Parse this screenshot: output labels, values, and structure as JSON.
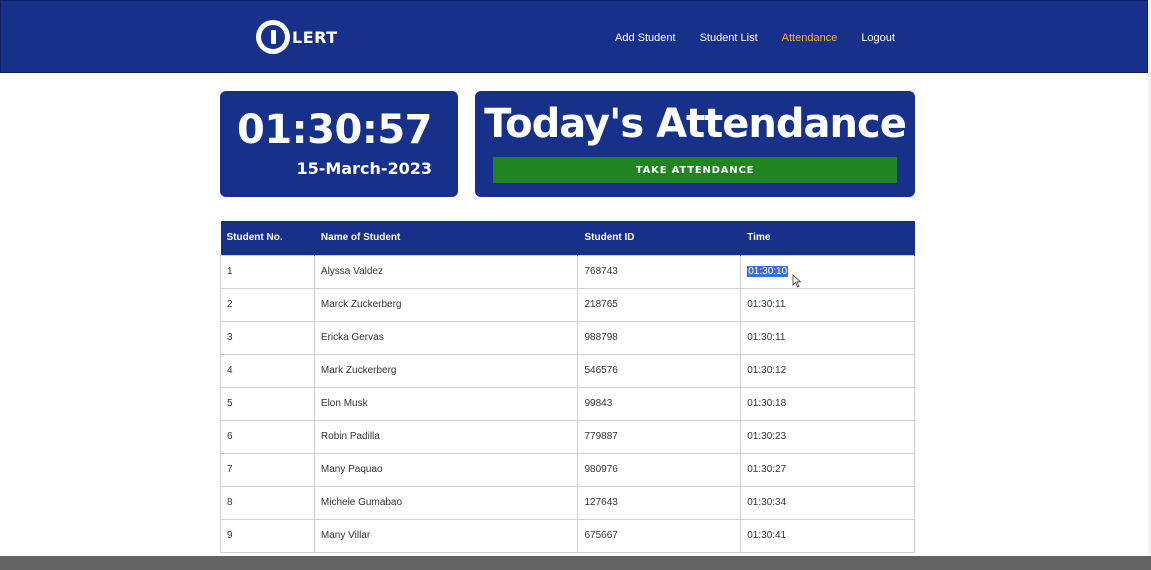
{
  "brand": {
    "logo_text": "LERT"
  },
  "nav": {
    "items": [
      {
        "label": "Add Student",
        "active": false
      },
      {
        "label": "Student List",
        "active": false
      },
      {
        "label": "Attendance",
        "active": true
      },
      {
        "label": "Logout",
        "active": false
      }
    ]
  },
  "clock": {
    "time": "01:30:57",
    "date": "15-March-2023"
  },
  "attendance": {
    "title": "Today's Attendance",
    "take_button_label": "TAKE ATTENDANCE"
  },
  "table": {
    "headers": [
      "Student No.",
      "Name of Student",
      "Student ID",
      "Time"
    ],
    "rows": [
      {
        "no": "1",
        "name": "Alyssa Valdez",
        "id": "768743",
        "time": "01:30:10"
      },
      {
        "no": "2",
        "name": "Marck Zuckerberg",
        "id": "218765",
        "time": "01:30:11"
      },
      {
        "no": "3",
        "name": "Ericka Gervas",
        "id": "988798",
        "time": "01:30:11"
      },
      {
        "no": "4",
        "name": "Mark Zuckerberg",
        "id": "546576",
        "time": "01:30:12"
      },
      {
        "no": "5",
        "name": "Elon Musk",
        "id": "99843",
        "time": "01:30:18"
      },
      {
        "no": "6",
        "name": "Robin Padilla",
        "id": "779887",
        "time": "01:30:23"
      },
      {
        "no": "7",
        "name": "Many Paquao",
        "id": "980976",
        "time": "01:30:27"
      },
      {
        "no": "8",
        "name": "Michele Gumabao",
        "id": "127643",
        "time": "01:30:34"
      },
      {
        "no": "9",
        "name": "Many Villar",
        "id": "675667",
        "time": "01:30:41"
      }
    ]
  },
  "colors": {
    "primary": "#17308a",
    "accent_active_nav": "#f0b93a",
    "button_green": "#208520",
    "selection": "#3b6fd6"
  },
  "icons": {
    "logo": "power-ring-icon",
    "cursor": "mouse-pointer-icon"
  }
}
